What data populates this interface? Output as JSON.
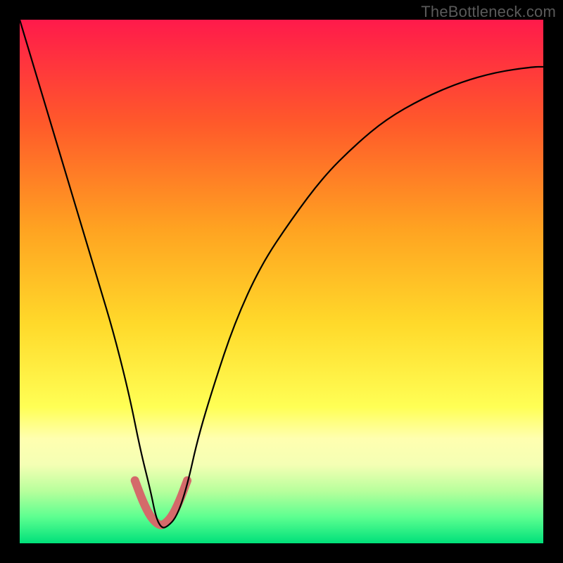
{
  "watermark": "TheBottleneck.com",
  "chart_data": {
    "type": "line",
    "title": "",
    "xlabel": "",
    "ylabel": "",
    "xlim": [
      0,
      100
    ],
    "ylim": [
      0,
      100
    ],
    "grid": false,
    "legend": false,
    "gradient_stops": [
      {
        "offset": 0.0,
        "color": "#ff1a4b"
      },
      {
        "offset": 0.2,
        "color": "#ff5a2a"
      },
      {
        "offset": 0.4,
        "color": "#ffa321"
      },
      {
        "offset": 0.58,
        "color": "#ffd92a"
      },
      {
        "offset": 0.74,
        "color": "#ffff55"
      },
      {
        "offset": 0.8,
        "color": "#ffffb0"
      },
      {
        "offset": 0.85,
        "color": "#f4ffb4"
      },
      {
        "offset": 0.9,
        "color": "#b8ff9c"
      },
      {
        "offset": 0.95,
        "color": "#5cff90"
      },
      {
        "offset": 1.0,
        "color": "#00e07a"
      }
    ],
    "series": [
      {
        "name": "bottleneck-curve",
        "color": "#000000",
        "width": 2.2,
        "x": [
          0,
          3,
          6,
          9,
          12,
          15,
          18,
          21,
          23,
          25,
          26,
          27,
          28,
          30,
          32,
          34,
          37,
          41,
          46,
          52,
          58,
          64,
          70,
          77,
          84,
          91,
          98,
          100
        ],
        "values": [
          100,
          90,
          80,
          70,
          60,
          50,
          40,
          28,
          18,
          10,
          5,
          3,
          3,
          5,
          11,
          20,
          30,
          42,
          53,
          62,
          70,
          76,
          81,
          85,
          88,
          90,
          91,
          91
        ]
      },
      {
        "name": "highlight-u",
        "color": "#d46a6a",
        "width": 12,
        "linecap": "round",
        "x": [
          22.0,
          23.5,
          25.0,
          26.5,
          27.5,
          29.0,
          30.5,
          32.0
        ],
        "values": [
          12.0,
          8.0,
          5.0,
          3.5,
          3.5,
          5.0,
          8.0,
          12.0
        ]
      }
    ]
  }
}
